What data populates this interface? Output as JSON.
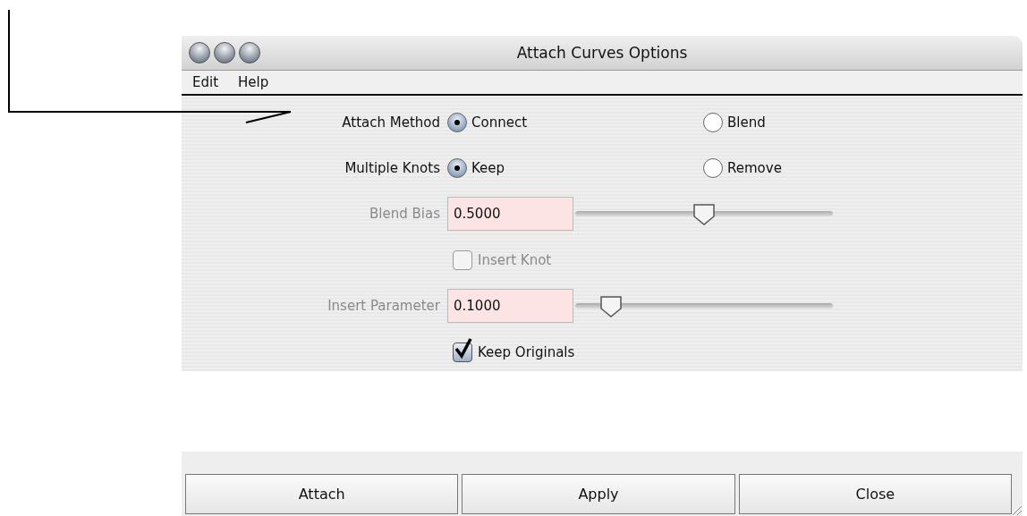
{
  "window": {
    "title": "Attach Curves Options"
  },
  "menu": [
    "Edit",
    "Help"
  ],
  "options": [
    {
      "kind": "radio",
      "label": "Attach Method",
      "disabled": false,
      "choices": [
        {
          "label": "Connect",
          "selected": true
        },
        {
          "label": "Blend",
          "selected": false
        }
      ]
    },
    {
      "kind": "radio",
      "label": "Multiple Knots",
      "disabled": false,
      "choices": [
        {
          "label": "Keep",
          "selected": true
        },
        {
          "label": "Remove",
          "selected": false
        }
      ]
    },
    {
      "kind": "slider",
      "label": "Blend Bias",
      "value": "0.5000",
      "level": 0.5,
      "disabled": true
    },
    {
      "kind": "checkbox",
      "label": "Insert Knot",
      "checked": false,
      "disabled": true
    },
    {
      "kind": "slider",
      "label": "Insert Parameter",
      "value": "0.1000",
      "level": 0.1,
      "disabled": true
    },
    {
      "kind": "checkbox",
      "label": "Keep Originals",
      "checked": true,
      "disabled": false
    }
  ],
  "buttons": [
    "Attach",
    "Apply",
    "Close"
  ]
}
